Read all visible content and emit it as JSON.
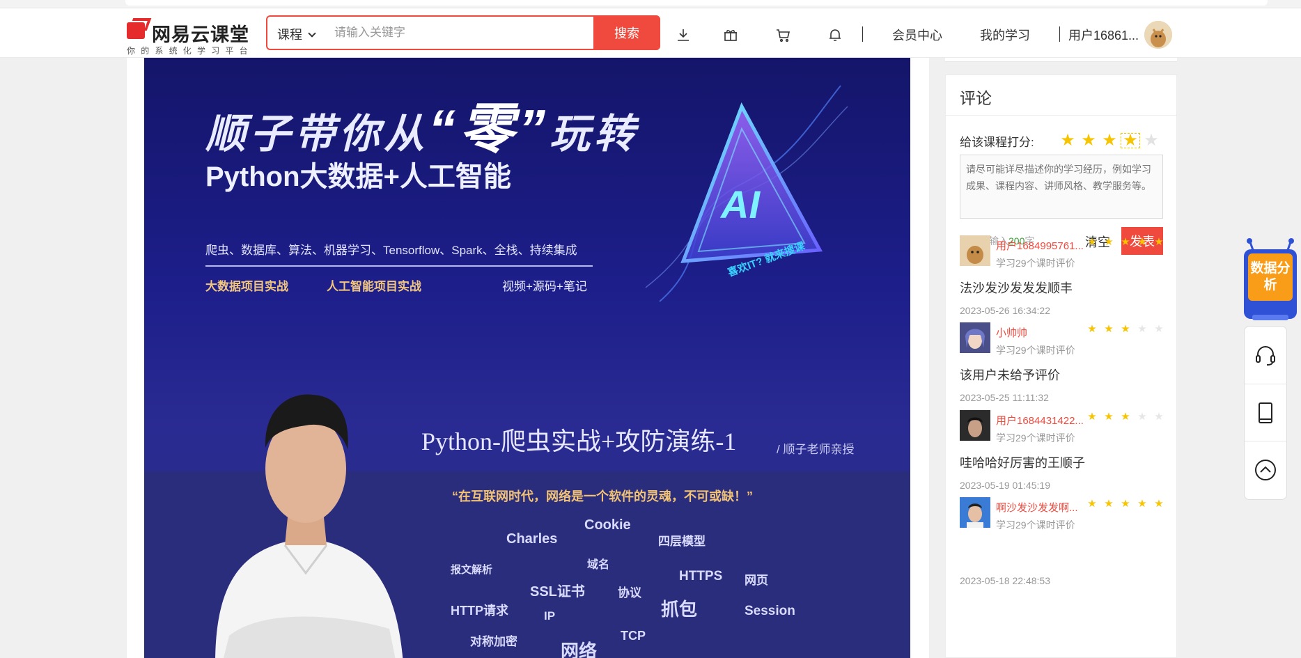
{
  "header": {
    "logo_title": "网易云课堂",
    "logo_subtitle": "你的系统化学习平台",
    "search_category": "课程",
    "search_placeholder": "请输入关键字",
    "search_button": "搜索",
    "icons": [
      "download-icon",
      "gift-icon",
      "cart-icon",
      "bell-icon"
    ],
    "links": {
      "member": "会员中心",
      "my_learning": "我的学习",
      "username": "用户16861..."
    }
  },
  "banner": {
    "title_prefix": "顺子带你从",
    "title_zero": "“零”",
    "title_suffix": "玩转",
    "subtitle": "Python大数据+人工智能",
    "tags": "爬虫、数据库、算法、机器学习、Tensorflow、Spark、全栈、持续集成",
    "features": [
      "大数据项目实战",
      "人工智能项目实战",
      "视频+源码+笔记"
    ],
    "ai_label": "AI",
    "ai_slogan": "喜欢IT? 就来搜课",
    "course_name": "Python-爬虫实战+攻防演练-1",
    "teacher": "/ 顺子老师亲授",
    "quote": "“在互联网时代，网络是一个软件的灵魂，不可或缺！”",
    "keywords": [
      "Cookie",
      "Charles",
      "四层模型",
      "域名",
      "报文解析",
      "HTTPS",
      "网页",
      "SSL证书",
      "协议",
      "HTTP请求",
      "抓包",
      "Session",
      "IP",
      "对称加密",
      "TCP",
      "网络"
    ]
  },
  "comments": {
    "title": "评论",
    "rate_label": "给该课程打分:",
    "rate_value": 4,
    "rate_max": 5,
    "textarea_placeholder": "请尽可能详尽描述你的学习经历，例如学习成果、课程内容、讲师风格、教学服务等。",
    "remain_prefix": "还可以输入",
    "remain_count": "200",
    "remain_suffix": "字",
    "clear_label": "清空",
    "post_label": "发表",
    "reviews": [
      {
        "user": "用户1684995761...",
        "rating": 5,
        "meta": "学习29个课时评价",
        "text": "法沙发沙发发发顺丰",
        "date": "2023-05-26 16:34:22"
      },
      {
        "user": "小帅帅",
        "rating": 3,
        "meta": "学习29个课时评价",
        "text": "该用户未给予评价",
        "date": "2023-05-25 11:11:32"
      },
      {
        "user": "用户1684431422...",
        "rating": 3,
        "meta": "学习29个课时评价",
        "text": "哇哈哈好厉害的王顺子",
        "date": "2023-05-19 01:45:19"
      },
      {
        "user": "啊沙发沙发发啊...",
        "rating": 5,
        "meta": "学习29个课时评价",
        "text": "",
        "date": "2023-05-18 22:48:53"
      }
    ]
  },
  "side": {
    "data_analysis": "数据分析",
    "tools": [
      "headset-icon",
      "tablet-icon",
      "back-to-top-icon"
    ]
  },
  "colors": {
    "accent": "#f04a3e",
    "star": "#f6c400",
    "banner_bg": "#1d1e8a"
  }
}
